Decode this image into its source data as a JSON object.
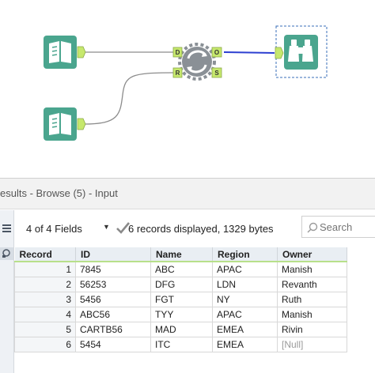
{
  "workflow": {
    "input1_name": "input-data-tool-1",
    "input2_name": "input-data-tool-2",
    "join_tool_name": "join-tool",
    "browse_tool_name": "browse-tool",
    "join_anchors": {
      "d_in": "D",
      "r_in": "R",
      "o_out": "O",
      "s_out": "S"
    },
    "colors": {
      "tool_teal": "#4aa58e",
      "anchor_green": "#c6e86d",
      "connector_blue": "#2c3fd1",
      "connector_gray": "#8c8c8c"
    }
  },
  "results": {
    "title": "esults - Browse (5) - Input",
    "fields_label": "4 of 4 Fields",
    "records_label": "6 records displayed, 1329 bytes",
    "search_placeholder": "Search",
    "columns": [
      "Record",
      "ID",
      "Name",
      "Region",
      "Owner"
    ],
    "rows": [
      {
        "record": "1",
        "id": "7845",
        "name": "ABC",
        "region": "APAC",
        "owner": "Manish"
      },
      {
        "record": "2",
        "id": "56253",
        "name": "DFG",
        "region": "LDN",
        "owner": "Revanth"
      },
      {
        "record": "3",
        "id": "5456",
        "name": "FGT",
        "region": "NY",
        "owner": "Ruth"
      },
      {
        "record": "4",
        "id": "ABC56",
        "name": "TYY",
        "region": "APAC",
        "owner": "Manish"
      },
      {
        "record": "5",
        "id": "CARTB56",
        "name": "MAD",
        "region": "EMEA",
        "owner": "Rivin"
      },
      {
        "record": "6",
        "id": "5454",
        "name": "ITC",
        "region": "EMEA",
        "owner": "[Null]"
      }
    ]
  }
}
